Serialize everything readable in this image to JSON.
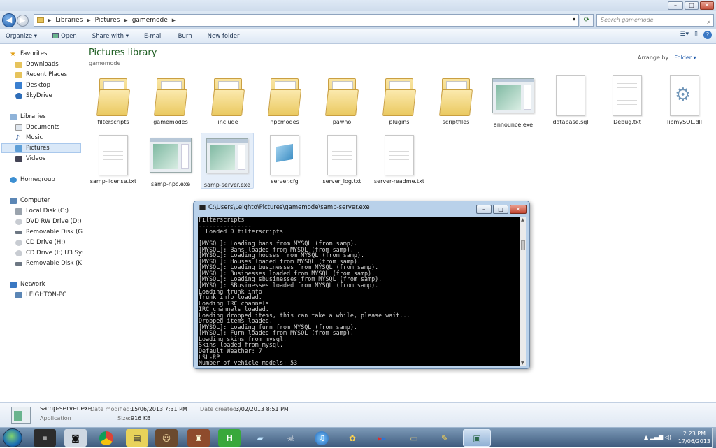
{
  "window": {
    "minimize_label": "–",
    "maximize_label": "□",
    "close_label": "✕"
  },
  "address": {
    "crumbs": [
      "Libraries",
      "Pictures",
      "gamemode"
    ],
    "search_placeholder": "Search gamemode"
  },
  "toolbar": {
    "organize": "Organize ▾",
    "open": "Open",
    "share_with": "Share with ▾",
    "email": "E-mail",
    "burn": "Burn",
    "new_folder": "New folder"
  },
  "nav": {
    "favorites": "Favorites",
    "downloads": "Downloads",
    "recent_places": "Recent Places",
    "desktop": "Desktop",
    "skydrive": "SkyDrive",
    "libraries": "Libraries",
    "documents": "Documents",
    "music": "Music",
    "pictures": "Pictures",
    "videos": "Videos",
    "homegroup": "Homegroup",
    "computer": "Computer",
    "local_disk": "Local Disk (C:)",
    "dvd_drive": "DVD RW Drive (D:) T",
    "removable_g": "Removable Disk (G:)",
    "cd_h": "CD Drive (H:)",
    "cd_i": "CD Drive (I:) U3 Syste",
    "removable_k": "Removable Disk (K:)",
    "network": "Network",
    "pc": "LEIGHTON-PC"
  },
  "library": {
    "title": "Pictures library",
    "subtitle": "gamemode",
    "arrange_label": "Arrange by:",
    "arrange_value": "Folder ▾"
  },
  "files": [
    {
      "name": "filterscripts",
      "kind": "folder"
    },
    {
      "name": "gamemodes",
      "kind": "folder"
    },
    {
      "name": "include",
      "kind": "folder"
    },
    {
      "name": "npcmodes",
      "kind": "folder"
    },
    {
      "name": "pawno",
      "kind": "folder"
    },
    {
      "name": "plugins",
      "kind": "folder"
    },
    {
      "name": "scriptfiles",
      "kind": "folder"
    },
    {
      "name": "announce.exe",
      "kind": "exe"
    },
    {
      "name": "database.sql",
      "kind": "doc"
    },
    {
      "name": "Debug.txt",
      "kind": "txt"
    },
    {
      "name": "libmySQL.dll",
      "kind": "dll"
    },
    {
      "name": "samp-license.txt",
      "kind": "txt"
    },
    {
      "name": "samp-npc.exe",
      "kind": "exe"
    },
    {
      "name": "samp-server.exe",
      "kind": "exe"
    },
    {
      "name": "server.cfg",
      "kind": "cfg"
    },
    {
      "name": "server_log.txt",
      "kind": "txt"
    },
    {
      "name": "server-readme.txt",
      "kind": "txt"
    }
  ],
  "console": {
    "title": "C:\\Users\\Leighto\\Pictures\\gamemode\\samp-server.exe",
    "lines": [
      "Filterscripts",
      "---------------",
      "  Loaded 0 filterscripts.",
      "",
      "[MYSQL]: Loading bans from MYSQL (from samp).",
      "[MYSQL]: Bans loaded from MYSQL (from samp).",
      "[MYSQL]: Loading houses from MYSQL (from samp).",
      "[MYSQL]: Houses loaded from MYSQL (from samp).",
      "[MYSQL]: Loading businesses from MYSQL (from samp).",
      "[MYSQL]: Businesses loaded from MYSQL (from samp).",
      "[MYSQL]: Loading sbusinesses from MYSQL (from samp).",
      "[MYSQL]: SBusinesses loaded from MYSQL (from samp).",
      "Loading trunk info",
      "Trunk info loaded.",
      "Loading IRC channels",
      "IRC channels loaded.",
      "Loading dropped items, this can take a while, please wait...",
      "Dropped items loaded.",
      "[MYSQL]: Loading furn from MYSQL (from samp).",
      "[MYSQL]: Furn loaded from MYSQL (from samp).",
      "Loading skins from mysql.",
      "Skins loaded from mysql.",
      "Default Weather: 7",
      "LSL-RP",
      "Number of vehicle models: 53"
    ]
  },
  "details": {
    "name": "samp-server.exe",
    "type": "Application",
    "modified_label": "Date modified:",
    "modified_value": "15/06/2013 7:31 PM",
    "created_label": "Date created:",
    "created_value": "3/02/2013 8:51 PM",
    "size_label": "Size:",
    "size_value": "916 KB"
  },
  "taskbar": {
    "time": "2:23 PM",
    "date": "17/06/2013"
  },
  "colors": {
    "accent": "#1e5e22",
    "link": "#1a56a8",
    "console_bg": "#000000"
  }
}
